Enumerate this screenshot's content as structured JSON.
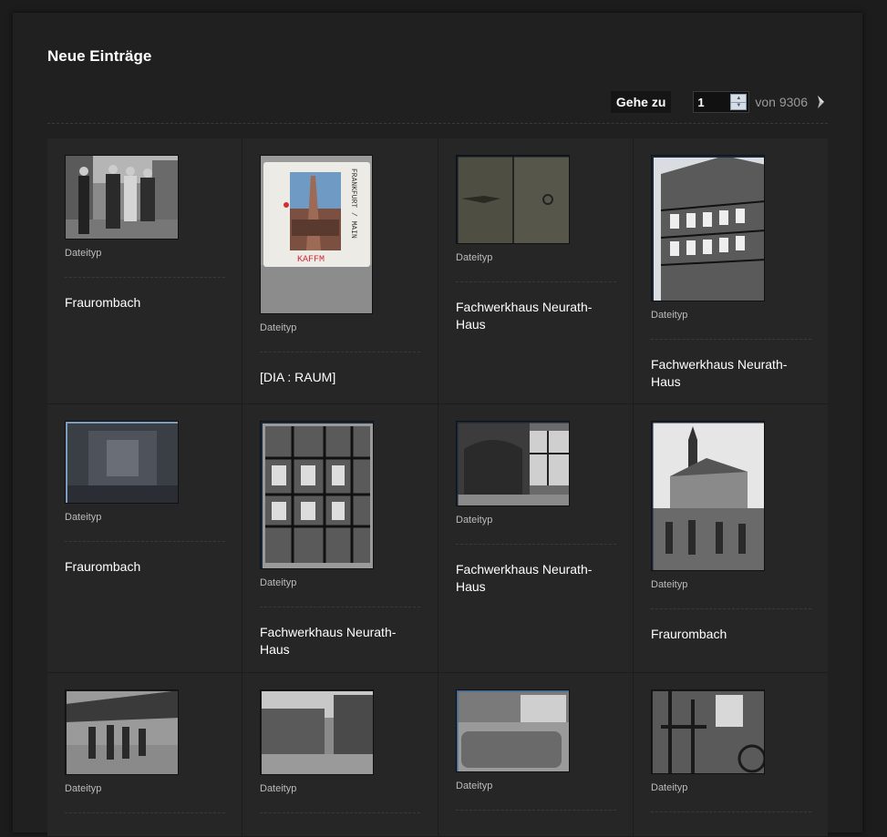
{
  "header": {
    "title": "Neue Einträge"
  },
  "pager": {
    "goto_label": "Gehe zu",
    "current_page": "1",
    "of_label": "von 9306"
  },
  "items": [
    {
      "filetype": "Dateityp",
      "title": "Fraurombach"
    },
    {
      "filetype": "Dateityp",
      "title": "[DIA : RAUM]"
    },
    {
      "filetype": "Dateityp",
      "title": "Fachwerkhaus Neurath-Haus"
    },
    {
      "filetype": "Dateityp",
      "title": "Fachwerkhaus Neurath-Haus"
    },
    {
      "filetype": "Dateityp",
      "title": "Fraurombach"
    },
    {
      "filetype": "Dateityp",
      "title": "Fachwerkhaus Neurath-Haus"
    },
    {
      "filetype": "Dateityp",
      "title": "Fachwerkhaus Neurath-Haus"
    },
    {
      "filetype": "Dateityp",
      "title": "Fraurombach"
    },
    {
      "filetype": "Dateityp",
      "title": ""
    },
    {
      "filetype": "Dateityp",
      "title": ""
    },
    {
      "filetype": "Dateityp",
      "title": ""
    },
    {
      "filetype": "Dateityp",
      "title": ""
    }
  ],
  "slide_label": {
    "handwriting": "FRANKFURT / MAIN",
    "stamp": "KAFFM"
  }
}
